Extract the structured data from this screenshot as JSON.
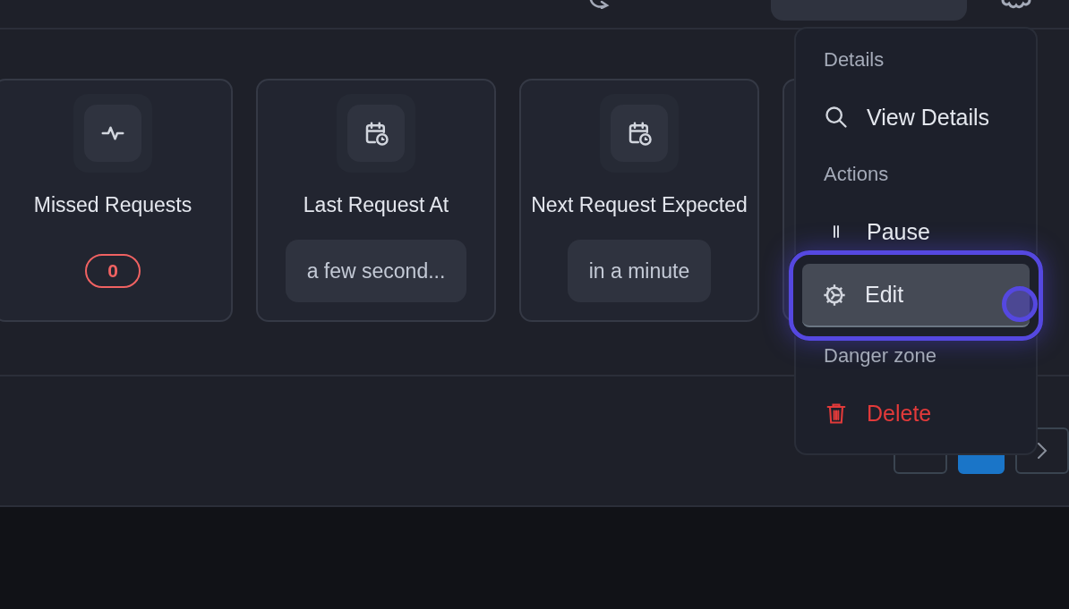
{
  "stat_cards": [
    {
      "label": "Missed Requests",
      "value": "0",
      "kind": "badge"
    },
    {
      "label": "Last Request At",
      "value": "a few second...",
      "kind": "pill"
    },
    {
      "label": "Next Request Expected",
      "value": "in a minute",
      "kind": "pill"
    }
  ],
  "pagination": {
    "pages": [
      {
        "selected": true
      }
    ]
  },
  "menu": {
    "sections": [
      {
        "title": "Details",
        "items": [
          {
            "label": "View Details",
            "kind": "search",
            "selected": false,
            "danger": false
          }
        ]
      },
      {
        "title": "Actions",
        "items": [
          {
            "label": "Pause",
            "kind": "pause",
            "selected": false,
            "danger": false
          },
          {
            "label": "Edit",
            "kind": "gear",
            "selected": true,
            "danger": false
          }
        ]
      },
      {
        "title": "Danger zone",
        "items": [
          {
            "label": "Delete",
            "kind": "trash",
            "selected": false,
            "danger": true
          }
        ]
      }
    ]
  }
}
